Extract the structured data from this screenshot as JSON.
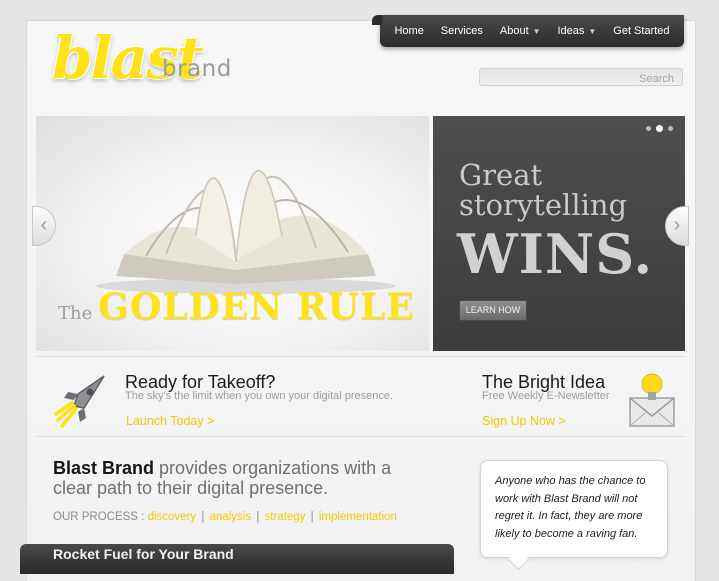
{
  "logo": {
    "blast": "blast",
    "brand": "brand"
  },
  "nav": {
    "items": [
      {
        "label": "Home",
        "dropdown": false
      },
      {
        "label": "Services",
        "dropdown": false
      },
      {
        "label": "About",
        "dropdown": true
      },
      {
        "label": "Ideas",
        "dropdown": true
      },
      {
        "label": "Get Started",
        "dropdown": false
      }
    ]
  },
  "search": {
    "placeholder": "Search"
  },
  "slider": {
    "left": {
      "the": "The",
      "rule": "GOLDEN RULE"
    },
    "right": {
      "line1": "Great",
      "line2": "storytelling",
      "big": "WINS.",
      "button": "LEARN HOW"
    },
    "dots": 3,
    "active_dot": 2,
    "prev_arrow": "‹",
    "next_arrow": "›"
  },
  "feature_left": {
    "title": "Ready for Takeoff?",
    "subtitle": "The sky's the limit when you own your digital presence.",
    "link": "Launch Today >",
    "icon": "rocket-icon"
  },
  "feature_right": {
    "title": "The Bright Idea",
    "subtitle": "Free Weekly E-Newsletter",
    "link": "Sign Up Now >",
    "icon": "lightbulb-envelope-icon"
  },
  "about": {
    "strong": "Blast Brand",
    "rest": " provides organizations with a clear path to their digital presence."
  },
  "process": {
    "label": "OUR PROCESS : ",
    "steps": [
      "discovery",
      "analysis",
      "strategy",
      "implementation"
    ],
    "separator": "|"
  },
  "testimonial": {
    "text": "Anyone who has the chance to work with Blast Brand will not regret it. In fact, they are more likely to become a raving fan."
  },
  "bottom_bar": {
    "title": "Rocket Fuel for Your Brand"
  },
  "colors": {
    "accent": "#f2cc00",
    "logo_yellow": "#ffe21a",
    "nav_dark": "#2c2c2e"
  }
}
